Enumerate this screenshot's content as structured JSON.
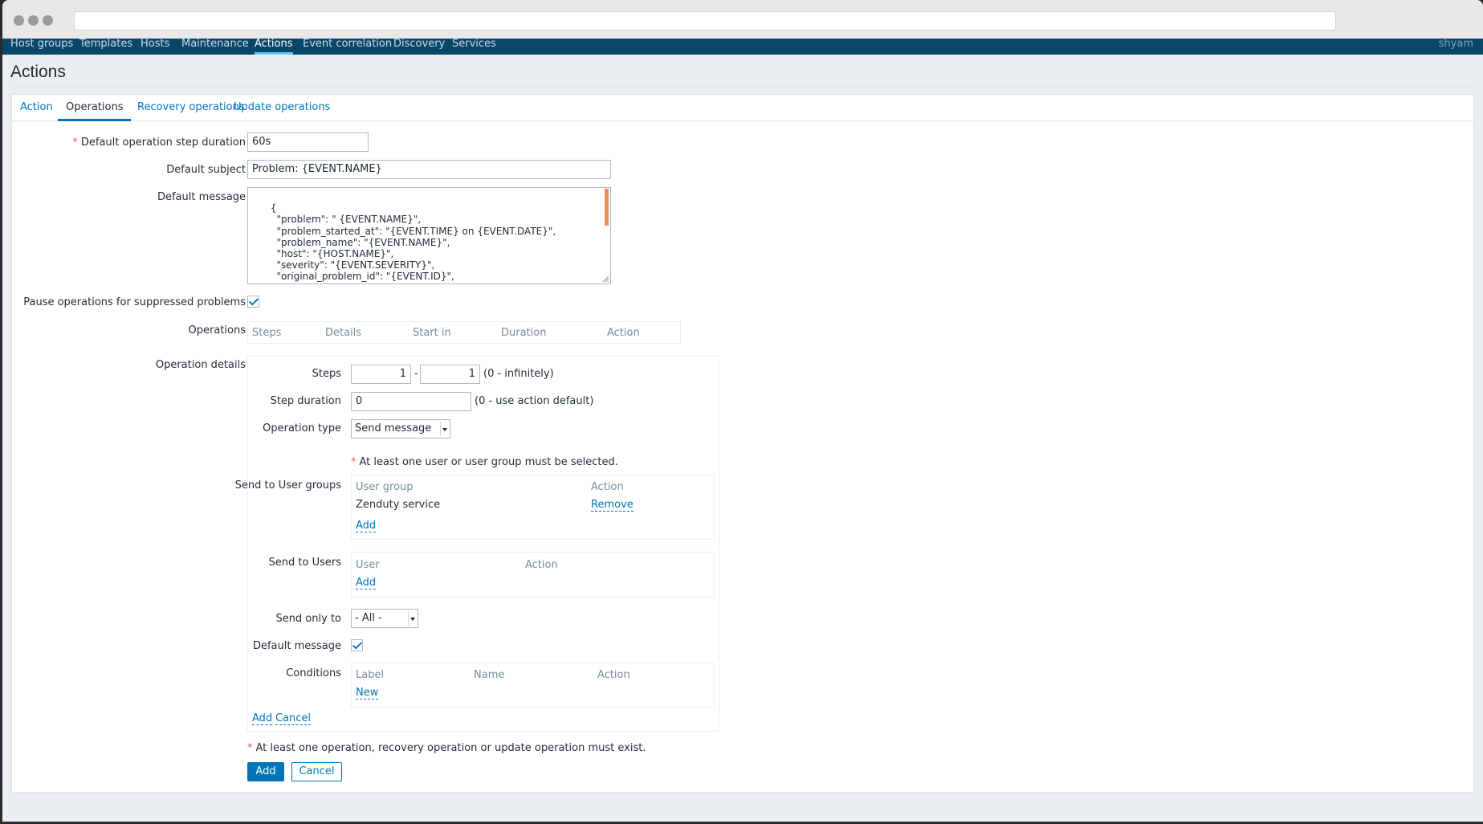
{
  "nav": {
    "items": [
      "Host groups",
      "Templates",
      "Hosts",
      "Maintenance",
      "Actions",
      "Event correlation",
      "Discovery",
      "Services"
    ],
    "active": "Actions",
    "user": "shyam"
  },
  "page": {
    "title": "Actions"
  },
  "tabs": [
    "Action",
    "Operations",
    "Recovery operations",
    "Update operations"
  ],
  "form": {
    "step_duration_label": "Default operation step duration",
    "step_duration_value": "60s",
    "subject_label": "Default subject",
    "subject_value": "Problem: {EVENT.NAME}",
    "message_label": "Default message",
    "message_value": "{\n        \"problem\": \" {EVENT.NAME}\",\n        \"problem_started_at\": \"{EVENT.TIME} on {EVENT.DATE}\",\n        \"problem_name\": \"{EVENT.NAME}\",\n        \"host\": \"{HOST.NAME}\",\n        \"severity\": \"{EVENT.SEVERITY}\",\n        \"original_problem_id\": \"{EVENT.ID}\",\n        \"event_status\":\"{EVENT.STATUS}\",",
    "pause_label": "Pause operations for suppressed problems",
    "operations_label": "Operations",
    "operations_headers": [
      "Steps",
      "Details",
      "Start in",
      "Duration",
      "Action"
    ],
    "op_details_label": "Operation details"
  },
  "details": {
    "steps_label": "Steps",
    "steps_from": "1",
    "steps_sep": "-",
    "steps_to": "1",
    "steps_hint": "(0 - infinitely)",
    "step_duration_label": "Step duration",
    "step_duration_value": "0",
    "step_duration_hint": "(0 - use action default)",
    "op_type_label": "Operation type",
    "op_type_value": "Send message",
    "required_note": "At least one user or user group must be selected.",
    "user_groups_label": "Send to User groups",
    "user_groups_headers": [
      "User group",
      "Action"
    ],
    "user_groups_rows": [
      {
        "name": "Zenduty service",
        "action": "Remove"
      }
    ],
    "user_groups_add": "Add",
    "users_label": "Send to Users",
    "users_headers": [
      "User",
      "Action"
    ],
    "users_add": "Add",
    "send_only_label": "Send only to",
    "send_only_value": "- All -",
    "default_message_label": "Default message",
    "conditions_label": "Conditions",
    "conditions_headers": [
      "Label",
      "Name",
      "Action"
    ],
    "conditions_new": "New",
    "add_link": "Add",
    "cancel_link": "Cancel"
  },
  "footer": {
    "note": "At least one operation, recovery operation or update operation must exist.",
    "add_button": "Add",
    "cancel_button": "Cancel"
  }
}
